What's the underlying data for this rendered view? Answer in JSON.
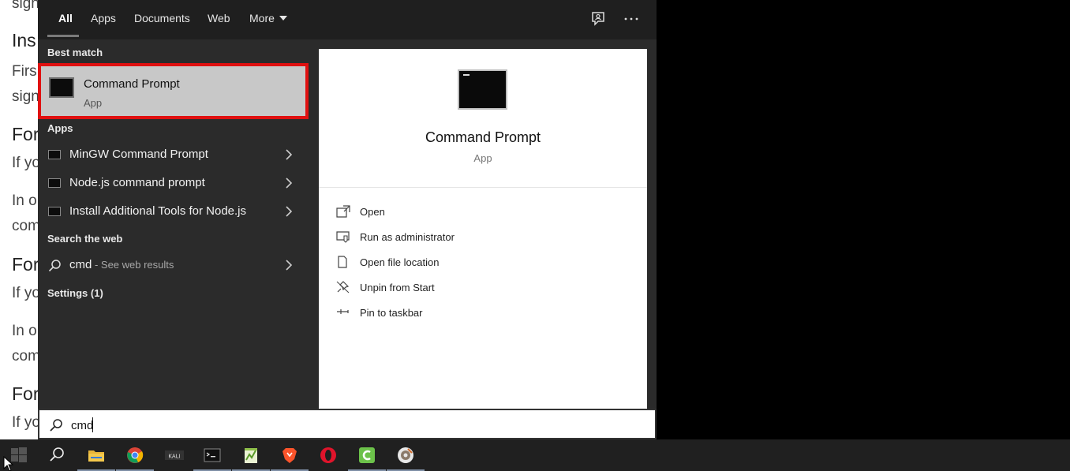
{
  "background_document": {
    "lines": [
      {
        "text": "sign"
      },
      {
        "text": "Ins"
      },
      {
        "text": "Firs"
      },
      {
        "text": "sign"
      },
      {
        "text": "For"
      },
      {
        "text": "If yo"
      },
      {
        "text": "In o"
      },
      {
        "text": "com"
      },
      {
        "text": "For"
      },
      {
        "text": "If yo"
      },
      {
        "text": "In o"
      },
      {
        "text": "com"
      },
      {
        "text": "For"
      },
      {
        "text": "If yo"
      }
    ]
  },
  "search_tabs": {
    "tabs": [
      "All",
      "Apps",
      "Documents",
      "Web",
      "More"
    ],
    "active": "All"
  },
  "results": {
    "best_match_heading": "Best match",
    "best_match": {
      "title": "Command Prompt",
      "type": "App",
      "highlight_color": "#e01010"
    },
    "apps_heading": "Apps",
    "apps": [
      {
        "label": "MinGW Command Prompt"
      },
      {
        "label": "Node.js command prompt"
      },
      {
        "label": "Install Additional Tools for Node.js"
      }
    ],
    "web_heading": "Search the web",
    "web_result": {
      "query": "cmd",
      "suffix": " - See web results"
    },
    "settings_heading": "Settings (1)"
  },
  "preview": {
    "title": "Command Prompt",
    "type": "App",
    "actions": [
      {
        "label": "Open",
        "icon": "open-icon"
      },
      {
        "label": "Run as administrator",
        "icon": "run-as-admin-icon"
      },
      {
        "label": "Open file location",
        "icon": "file-location-icon"
      },
      {
        "label": "Unpin from Start",
        "icon": "unpin-icon"
      },
      {
        "label": "Pin to taskbar",
        "icon": "pin-taskbar-icon"
      }
    ]
  },
  "search_box": {
    "value": "cmd"
  },
  "taskbar": {
    "items": [
      "start",
      "search",
      "file-explorer",
      "chrome",
      "kali",
      "terminal",
      "notepad-plus-plus",
      "brave",
      "opera",
      "camtasia",
      "media-player"
    ]
  }
}
